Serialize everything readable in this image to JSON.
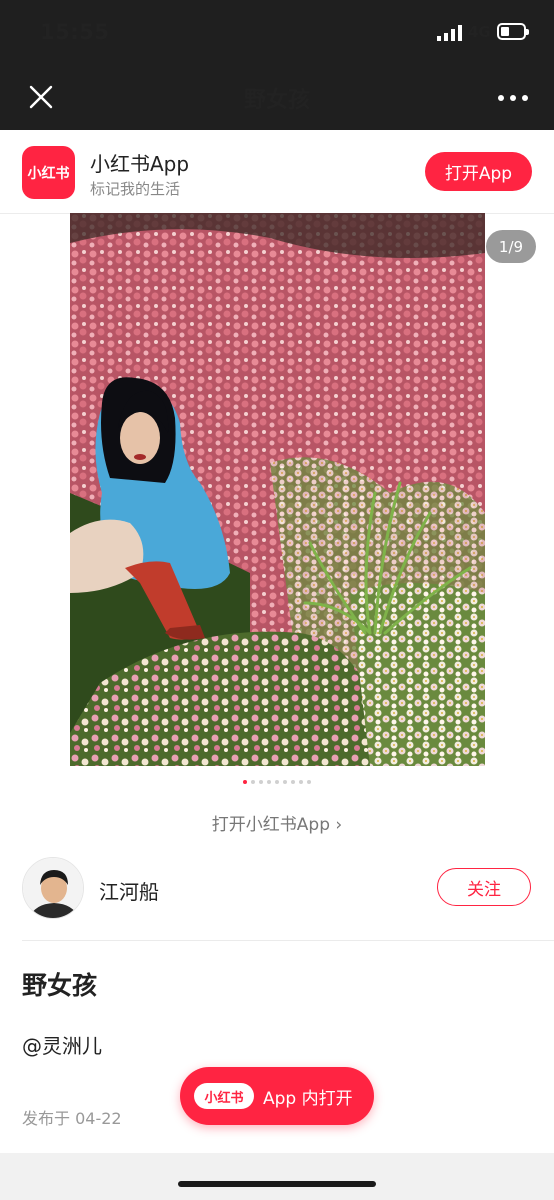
{
  "status_bar": {
    "time": "15:55",
    "network": "4G"
  },
  "nav": {
    "title": "野女孩"
  },
  "banner": {
    "logo_text": "小红书",
    "app_name": "小红书App",
    "slogan": "标记我的生活",
    "open_button": "打开App"
  },
  "photo": {
    "page_indicator": "1/9",
    "total_dots": 9,
    "active_dot": 0
  },
  "open_link": "打开小红书App ›",
  "author": {
    "name": "江河船",
    "follow_button": "关注"
  },
  "post": {
    "title": "野女孩",
    "mention": "@灵洲儿",
    "date": "发布于 04-22"
  },
  "float_button": {
    "logo_text": "小红书",
    "label": "App 内打开"
  },
  "colors": {
    "accent": "#ff2442",
    "topbar": "#1f1f1f"
  }
}
